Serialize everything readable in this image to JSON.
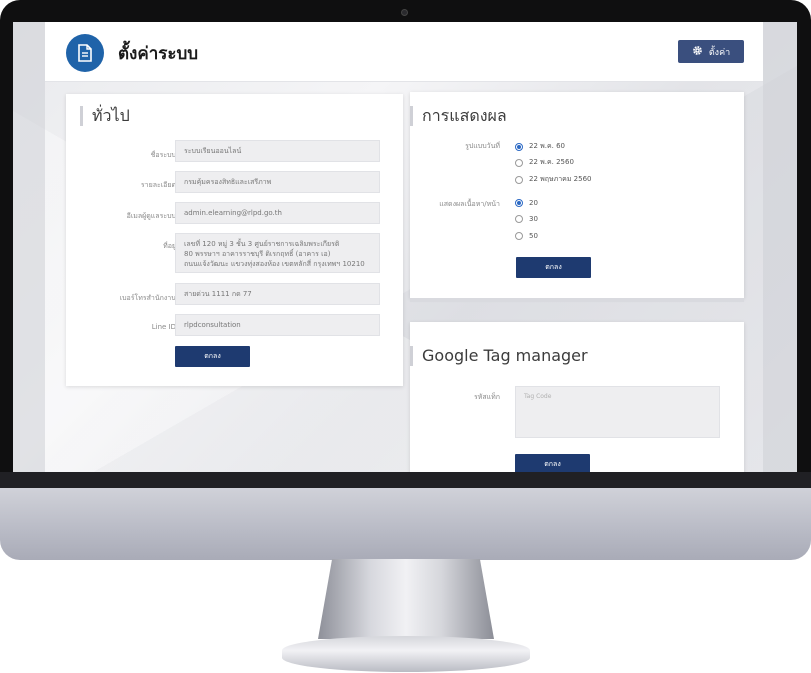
{
  "header": {
    "title": "ตั้งค่าระบบ",
    "settings_button": "ตั้งค่า",
    "page_icon": "document-icon",
    "settings_icon": "gear-icon"
  },
  "general": {
    "title": "ทั่วไป",
    "fields": [
      {
        "label": "ชื่อระบบ",
        "value": "ระบบเรียนออนไลน์"
      },
      {
        "label": "รายละเอียด",
        "value": "กรมคุ้มครองสิทธิและเสรีภาพ"
      },
      {
        "label": "อีเมลผู้ดูแลระบบ",
        "value": "admin.elearning@rlpd.go.th"
      },
      {
        "label": "ที่อยู่",
        "value": "เลขที่ 120 หมู่ 3 ชั้น 3 ศูนย์ราชการเฉลิมพระเกียรติ\n80 พรรษาฯ อาคารราชบุรี ดิเรกฤทธิ์ (อาคาร เอ)\nถนนแจ้งวัฒนะ แขวงทุ่งสองห้อง เขตหลักสี่ กรุงเทพฯ 10210"
      },
      {
        "label": "เบอร์โทรสำนักงาน",
        "value": "สายด่วน 1111 กด 77"
      },
      {
        "label": "Line ID",
        "value": "rlpdconsultation"
      }
    ],
    "submit": "ตกลง"
  },
  "display": {
    "title": "การแสดงผล",
    "date_format_label": "รูปแบบวันที่",
    "date_options": [
      "22 พ.ค. 60",
      "22 พ.ค. 2560",
      "22 พฤษภาคม 2560"
    ],
    "date_selected": 0,
    "per_page_label": "แสดงผลเนื้อหา/หน้า",
    "per_page_options": [
      "20",
      "30",
      "50"
    ],
    "per_page_selected": 0,
    "submit": "ตกลง"
  },
  "gtm": {
    "title": "Google Tag manager",
    "tag_label": "รหัสแท็ก",
    "tag_placeholder": "Tag Code",
    "submit": "ตกลง"
  },
  "colors": {
    "primary_button": "#1e3a70",
    "header_icon_bg": "#1f63a9",
    "radio_selected": "#2c69c4"
  }
}
